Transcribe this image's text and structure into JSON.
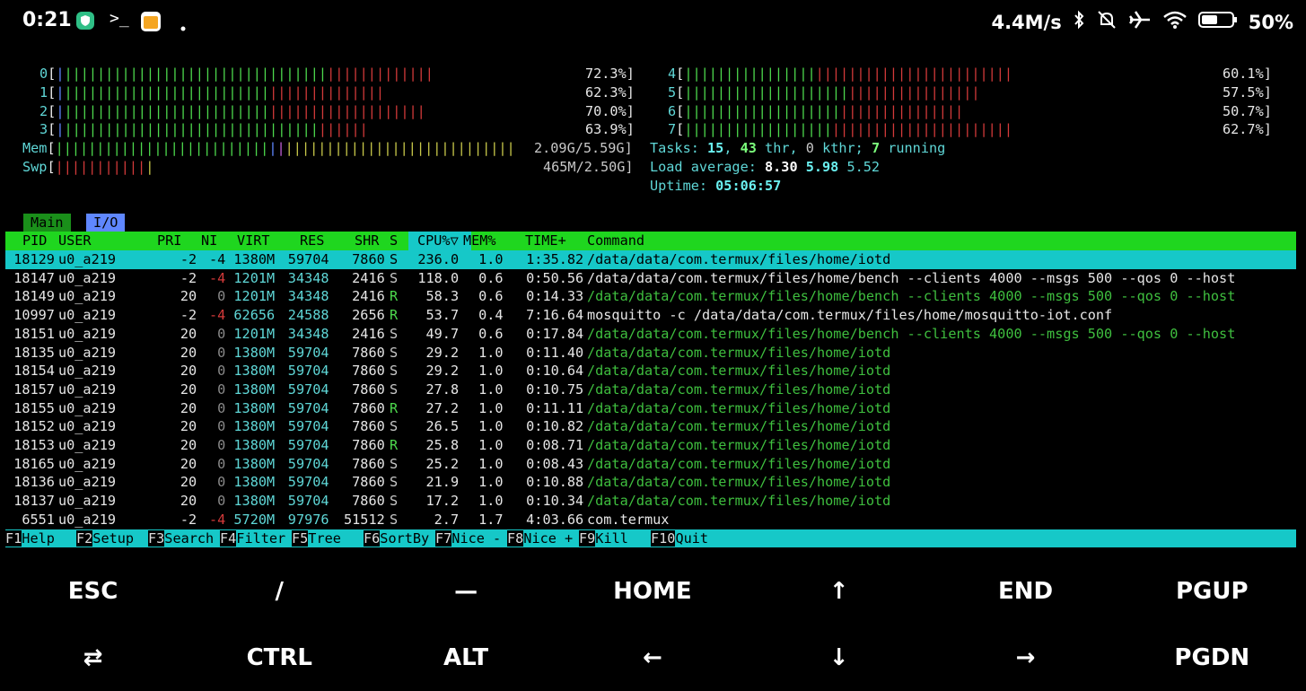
{
  "statusbar": {
    "time": "0:21",
    "net_speed": "4.4M/s",
    "battery": "50%",
    "icons": [
      "shield-icon",
      "terminal-icon",
      "notes-app-icon",
      "dot-icon",
      "bluetooth-icon",
      "bell-muted-icon",
      "airplane-icon",
      "wifi-icon",
      "battery-icon"
    ]
  },
  "cpu": [
    {
      "id": "0",
      "percent": "72.3%]"
    },
    {
      "id": "1",
      "percent": "62.3%]"
    },
    {
      "id": "2",
      "percent": "70.0%]"
    },
    {
      "id": "3",
      "percent": "63.9%]"
    },
    {
      "id": "4",
      "percent": "60.1%]"
    },
    {
      "id": "5",
      "percent": "57.5%]"
    },
    {
      "id": "6",
      "percent": "50.7%]"
    },
    {
      "id": "7",
      "percent": "62.7%]"
    }
  ],
  "mem": {
    "label": "Mem",
    "value": "2.09G/5.59G]"
  },
  "swp": {
    "label": "Swp",
    "value": "465M/2.50G]"
  },
  "tasks": {
    "label": "Tasks: ",
    "tasks": "15",
    "sep1": ", ",
    "thr": "43",
    "thr_label": " thr, ",
    "kthr": "0",
    "kthr_label": " kthr; ",
    "running": "7",
    "running_label": " running"
  },
  "load": {
    "label": "Load average: ",
    "one": "8.30",
    "five": "5.98",
    "fifteen": "5.52"
  },
  "uptime": {
    "label": "Uptime: ",
    "value": "05:06:57"
  },
  "tabs": {
    "main": "Main",
    "io": "I/O"
  },
  "columns": {
    "pid": "PID",
    "user": "USER",
    "pri": "PRI",
    "ni": "NI",
    "virt": "VIRT",
    "res": "RES",
    "shr": "SHR",
    "s": "S",
    "cpu": "CPU%",
    "sort_arrow": "▽",
    "mem": "MEM%",
    "time": "TIME+",
    "command": "Command"
  },
  "processes": [
    {
      "pid": "18129",
      "user": "u0_a219",
      "pri": "-2",
      "ni": "-4",
      "virt": "1380M",
      "res": "59704",
      "shr": "7860",
      "s": "S",
      "cpu": "236.0",
      "mem": "1.0",
      "time": "1:35.82",
      "command": "/data/data/com.termux/files/home/iotd"
    },
    {
      "pid": "18147",
      "user": "u0_a219",
      "pri": "-2",
      "ni": "-4",
      "virt": "1201M",
      "res": "34348",
      "shr": "2416",
      "s": "S",
      "cpu": "118.0",
      "mem": "0.6",
      "time": "0:50.56",
      "command": "/data/data/com.termux/files/home/bench --clients 4000 --msgs 500 --qos 0 --host"
    },
    {
      "pid": "18149",
      "user": "u0_a219",
      "pri": "20",
      "ni": "0",
      "virt": "1201M",
      "res": "34348",
      "shr": "2416",
      "s": "R",
      "cpu": "58.3",
      "mem": "0.6",
      "time": "0:14.33",
      "command": "/data/data/com.termux/files/home/bench --clients 4000 --msgs 500 --qos 0 --host"
    },
    {
      "pid": "10997",
      "user": "u0_a219",
      "pri": "-2",
      "ni": "-4",
      "virt": "62656",
      "res": "24588",
      "shr": "2656",
      "s": "R",
      "cpu": "53.7",
      "mem": "0.4",
      "time": "7:16.64",
      "command": "mosquitto -c /data/data/com.termux/files/home/mosquitto-iot.conf"
    },
    {
      "pid": "18151",
      "user": "u0_a219",
      "pri": "20",
      "ni": "0",
      "virt": "1201M",
      "res": "34348",
      "shr": "2416",
      "s": "S",
      "cpu": "49.7",
      "mem": "0.6",
      "time": "0:17.84",
      "command": "/data/data/com.termux/files/home/bench --clients 4000 --msgs 500 --qos 0 --host"
    },
    {
      "pid": "18135",
      "user": "u0_a219",
      "pri": "20",
      "ni": "0",
      "virt": "1380M",
      "res": "59704",
      "shr": "7860",
      "s": "S",
      "cpu": "29.2",
      "mem": "1.0",
      "time": "0:11.40",
      "command": "/data/data/com.termux/files/home/iotd"
    },
    {
      "pid": "18154",
      "user": "u0_a219",
      "pri": "20",
      "ni": "0",
      "virt": "1380M",
      "res": "59704",
      "shr": "7860",
      "s": "S",
      "cpu": "29.2",
      "mem": "1.0",
      "time": "0:10.64",
      "command": "/data/data/com.termux/files/home/iotd"
    },
    {
      "pid": "18157",
      "user": "u0_a219",
      "pri": "20",
      "ni": "0",
      "virt": "1380M",
      "res": "59704",
      "shr": "7860",
      "s": "S",
      "cpu": "27.8",
      "mem": "1.0",
      "time": "0:10.75",
      "command": "/data/data/com.termux/files/home/iotd"
    },
    {
      "pid": "18155",
      "user": "u0_a219",
      "pri": "20",
      "ni": "0",
      "virt": "1380M",
      "res": "59704",
      "shr": "7860",
      "s": "R",
      "cpu": "27.2",
      "mem": "1.0",
      "time": "0:11.11",
      "command": "/data/data/com.termux/files/home/iotd"
    },
    {
      "pid": "18152",
      "user": "u0_a219",
      "pri": "20",
      "ni": "0",
      "virt": "1380M",
      "res": "59704",
      "shr": "7860",
      "s": "S",
      "cpu": "26.5",
      "mem": "1.0",
      "time": "0:10.82",
      "command": "/data/data/com.termux/files/home/iotd"
    },
    {
      "pid": "18153",
      "user": "u0_a219",
      "pri": "20",
      "ni": "0",
      "virt": "1380M",
      "res": "59704",
      "shr": "7860",
      "s": "R",
      "cpu": "25.8",
      "mem": "1.0",
      "time": "0:08.71",
      "command": "/data/data/com.termux/files/home/iotd"
    },
    {
      "pid": "18165",
      "user": "u0_a219",
      "pri": "20",
      "ni": "0",
      "virt": "1380M",
      "res": "59704",
      "shr": "7860",
      "s": "S",
      "cpu": "25.2",
      "mem": "1.0",
      "time": "0:08.43",
      "command": "/data/data/com.termux/files/home/iotd"
    },
    {
      "pid": "18136",
      "user": "u0_a219",
      "pri": "20",
      "ni": "0",
      "virt": "1380M",
      "res": "59704",
      "shr": "7860",
      "s": "S",
      "cpu": "21.9",
      "mem": "1.0",
      "time": "0:10.88",
      "command": "/data/data/com.termux/files/home/iotd"
    },
    {
      "pid": "18137",
      "user": "u0_a219",
      "pri": "20",
      "ni": "0",
      "virt": "1380M",
      "res": "59704",
      "shr": "7860",
      "s": "S",
      "cpu": "17.2",
      "mem": "1.0",
      "time": "0:10.34",
      "command": "/data/data/com.termux/files/home/iotd"
    },
    {
      "pid": "6551",
      "user": "u0_a219",
      "pri": "-2",
      "ni": "-4",
      "virt": "5720M",
      "res": "97976",
      "shr": "51512",
      "s": "S",
      "cpu": "2.7",
      "mem": "1.7",
      "time": "4:03.66",
      "command": "com.termux"
    }
  ],
  "fkeys": [
    {
      "key": "F1",
      "label": "Help  "
    },
    {
      "key": "F2",
      "label": "Setup "
    },
    {
      "key": "F3",
      "label": "Search"
    },
    {
      "key": "F4",
      "label": "Filter"
    },
    {
      "key": "F5",
      "label": "Tree  "
    },
    {
      "key": "F6",
      "label": "SortBy"
    },
    {
      "key": "F7",
      "label": "Nice -"
    },
    {
      "key": "F8",
      "label": "Nice +"
    },
    {
      "key": "F9",
      "label": "Kill  "
    },
    {
      "key": "F10",
      "label": "Quit"
    }
  ],
  "extra_keys": {
    "row1": [
      "ESC",
      "/",
      "—",
      "HOME",
      "↑",
      "END",
      "PGUP"
    ],
    "row2": [
      "⇄",
      "CTRL",
      "ALT",
      "←",
      "↓",
      "→",
      "PGDN"
    ]
  },
  "colors": {
    "accent_green": "#1fd61f",
    "accent_cyan": "#16c8c8",
    "bar_red": "#d43a3a",
    "bar_green": "#4dd94d"
  }
}
